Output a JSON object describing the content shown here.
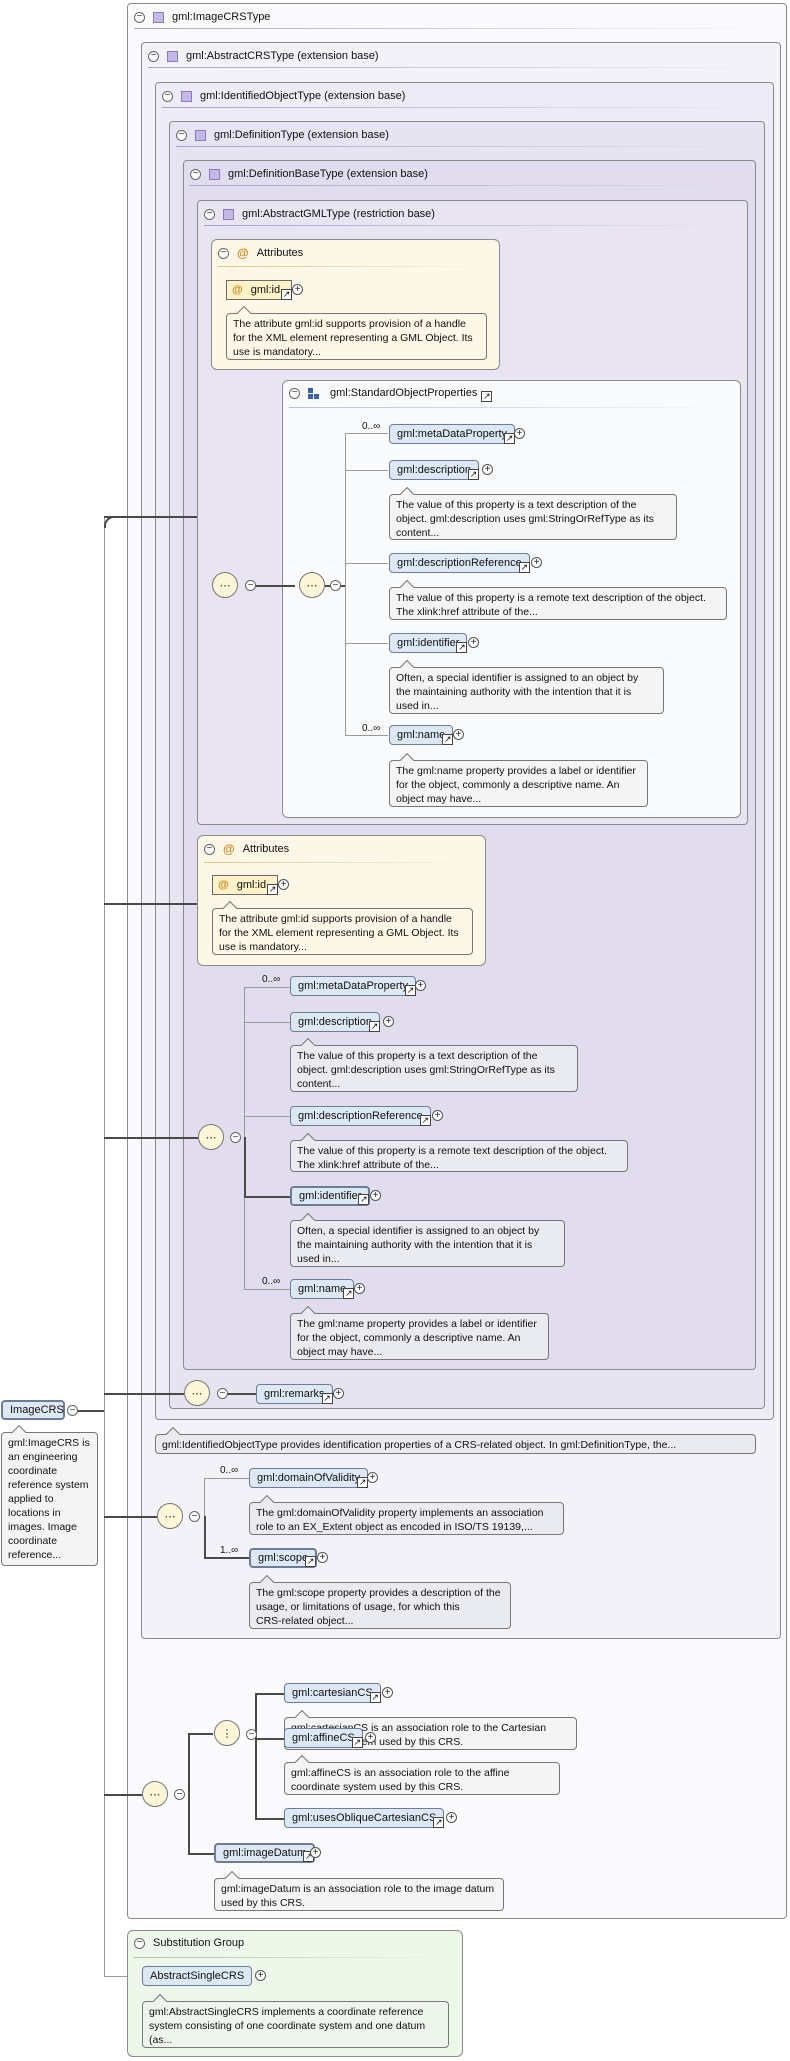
{
  "title": "gml:ImageCRSType",
  "frames": {
    "abstract_crs": "gml:AbstractCRSType (extension base)",
    "identified_object": "gml:IdentifiedObjectType (extension base)",
    "definition": "gml:DefinitionType (extension base)",
    "definition_base": "gml:DefinitionBaseType (extension base)",
    "abstract_gml": "gml:AbstractGMLType (restriction base)"
  },
  "attributes_label": "Attributes",
  "attr_id": "gml:id",
  "attr_id_doc": "The attribute gml:id supports provision of a handle\nfor the XML element representing a GML Object. Its\nuse is mandatory...",
  "standard_props": "gml:StandardObjectProperties",
  "occ_many": "0..∞",
  "occ_one_many": "1..∞",
  "props": {
    "metadata": "gml:metaDataProperty",
    "description": "gml:description",
    "description_doc": "The value of this property is a text description of the\nobject. gml:description uses gml:StringOrRefType as its\ncontent...",
    "description_ref": "gml:descriptionReference",
    "description_ref_doc": "The value of this property is a remote text description of the object.\nThe xlink:href attribute of the...",
    "identifier": "gml:identifier",
    "identifier_doc": "Often, a special identifier is assigned to an object by\nthe maintaining authority with the intention that it is\nused in...",
    "name": "gml:name",
    "name_doc": "The gml:name property provides a label or identifier\nfor the object, commonly a descriptive name. An\nobject may have..."
  },
  "remarks": "gml:remarks",
  "identified_doc": "gml:IdentifiedObjectType provides identification properties of a CRS-related object. In gml:DefinitionType, the...",
  "domain_of_validity": "gml:domainOfValidity",
  "domain_of_validity_doc": "The gml:domainOfValidity property implements an association\nrole to an EX_Extent object as encoded in ISO/TS 19139,...",
  "scope": "gml:scope",
  "scope_doc": "The gml:scope property provides a description of the\nusage, or limitations of usage, for which this\nCRS-related object...",
  "cartesian_cs": "gml:cartesianCS",
  "cartesian_cs_doc": "gml:cartesianCS is an association role to the Cartesian\ncoordinate system used by this CRS.",
  "affine_cs": "gml:affineCS",
  "affine_cs_doc": "gml:affineCS is an association role to the affine\ncoordinate system used by this CRS.",
  "uses_oblique": "gml:usesObliqueCartesianCS",
  "image_datum": "gml:imageDatum",
  "image_datum_doc": "gml:imageDatum is an association role to the image datum\nused by this CRS.",
  "root": "ImageCRS",
  "root_doc": "gml:ImageCRS is\nan engineering\ncoordinate\nreference system\napplied to\nlocations in\nimages. Image\ncoordinate\nreference...",
  "substitution_group": "Substitution Group",
  "abstract_single_crs": "AbstractSingleCRS",
  "abstract_single_crs_doc": "gml:AbstractSingleCRS implements a coordinate reference\nsystem consisting of one coordinate system and one datum\n(as..."
}
